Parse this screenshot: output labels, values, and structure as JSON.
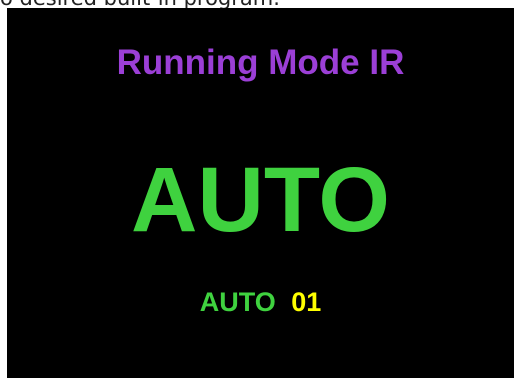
{
  "caption": {
    "text": "o desired built-in program."
  },
  "screen": {
    "title": "Running Mode IR",
    "mode": "AUTO",
    "program_label": "AUTO",
    "program_number": "01"
  },
  "colors": {
    "background": "#000000",
    "title": "#9b3fd6",
    "mode": "#3fd23f",
    "program_label": "#3fd23f",
    "program_number": "#ffff00"
  }
}
